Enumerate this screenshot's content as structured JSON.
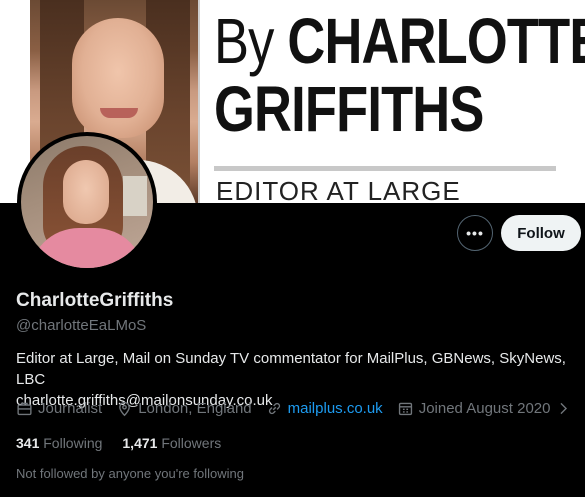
{
  "banner": {
    "by": "By",
    "first_name": "CHARLOTTE",
    "last_name": "GRIFFITHS",
    "role": "EDITOR AT LARGE"
  },
  "actions": {
    "more_label": "•••",
    "follow_label": "Follow"
  },
  "profile": {
    "name": "CharlotteGriffiths",
    "handle": "@charlotteEaLMoS",
    "bio_line1": "Editor at Large, Mail on Sunday TV commentator for MailPlus, GBNews, SkyNews, LBC",
    "bio_line2": "charlotte.griffiths@mailonsunday.co.uk",
    "occupation": "Journalist",
    "location": "London, England",
    "website": "mailplus.co.uk",
    "joined": "Joined August 2020",
    "following_count": "341",
    "following_label": "Following",
    "followers_count": "1,471",
    "followers_label": "Followers",
    "followed_note": "Not followed by anyone you're following"
  },
  "colors": {
    "background": "#000000",
    "link": "#1d9bf0",
    "secondary_text": "#71767b",
    "primary_text": "#e7e9ea"
  }
}
